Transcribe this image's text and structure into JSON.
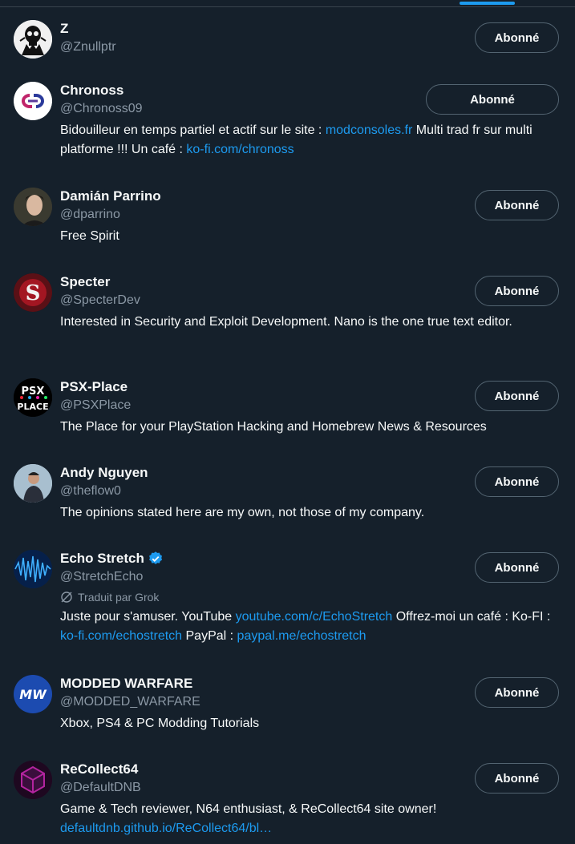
{
  "follow_label": "Abonné",
  "accounts": [
    {
      "name": "Z",
      "handle": "@Znullptr",
      "bio": []
    },
    {
      "name": "Chronoss",
      "handle": "@Chronoss09",
      "bio": [
        {
          "t": "Bidouilleur en temps partiel et actif sur le site : "
        },
        {
          "t": "modconsoles.fr",
          "link": true
        },
        {
          "t": " Multi trad fr sur multi platforme !!! Un café : "
        },
        {
          "t": "ko-fi.com/chronoss",
          "link": true
        }
      ]
    },
    {
      "name": "Damián Parrino",
      "handle": "@dparrino",
      "bio": [
        {
          "t": "Free Spirit"
        }
      ]
    },
    {
      "name": "Specter",
      "handle": "@SpecterDev",
      "bio": [
        {
          "t": "Interested in Security and Exploit Development. Nano is the one true text editor."
        }
      ]
    },
    {
      "name": "PSX-Place",
      "handle": "@PSXPlace",
      "bio": [
        {
          "t": "The Place for your PlayStation Hacking and Homebrew News & Resources"
        }
      ]
    },
    {
      "name": "Andy Nguyen",
      "handle": "@theflow0",
      "bio": [
        {
          "t": "The opinions stated here are my own, not those of my company."
        }
      ]
    },
    {
      "name": "Echo Stretch",
      "handle": "@StretchEcho",
      "verified": true,
      "translated": "Traduit par Grok",
      "bio": [
        {
          "t": "Juste pour s'amuser. YouTube "
        },
        {
          "t": "youtube.com/c/EchoStretch",
          "link": true
        },
        {
          "t": " Offrez-moi un café : Ko-FI : "
        },
        {
          "t": "ko-fi.com/echostretch",
          "link": true
        },
        {
          "t": " PayPal : "
        },
        {
          "t": "paypal.me/echostretch",
          "link": true
        }
      ]
    },
    {
      "name": "MODDED WARFARE",
      "handle": "@MODDED_WARFARE",
      "bio": [
        {
          "t": "Xbox, PS4 & PC Modding Tutorials"
        }
      ]
    },
    {
      "name": "ReCollect64",
      "handle": "@DefaultDNB",
      "bio": [
        {
          "t": "Game & Tech reviewer, N64 enthusiast, & ReCollect64 site owner! "
        },
        {
          "t": "defaultdnb.github.io/ReCollect64/bl…",
          "link": true
        }
      ]
    }
  ],
  "avatar_text": {
    "psx_place": [
      "PSX",
      "PLACE"
    ],
    "modded_warfare": "MW",
    "specter": "S"
  },
  "colors": {
    "background": "#15202b",
    "link": "#1d9bf0",
    "muted": "#8b98a5",
    "button_border": "#536471"
  }
}
